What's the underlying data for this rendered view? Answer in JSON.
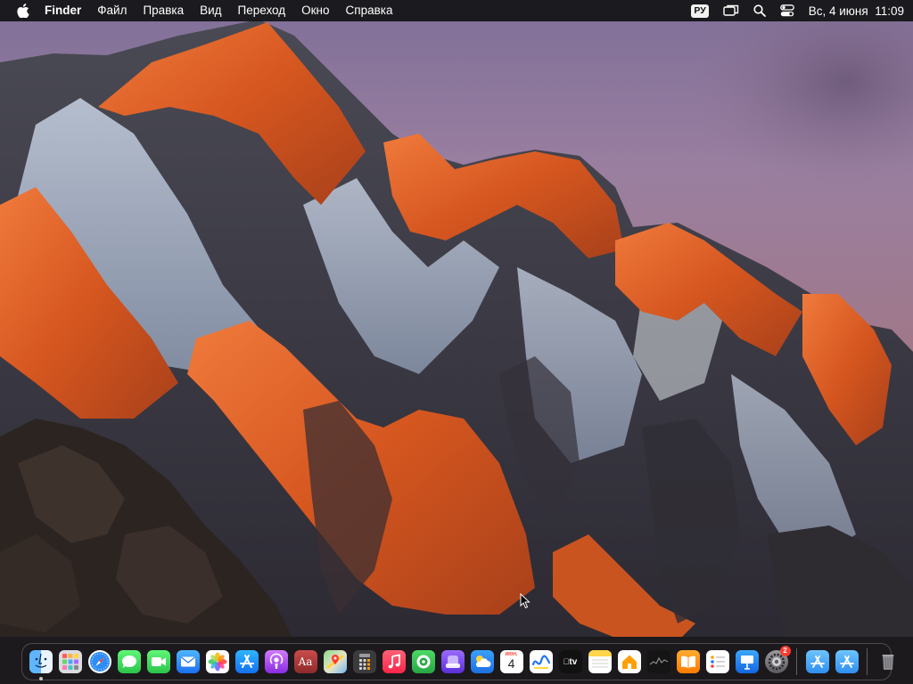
{
  "menubar": {
    "app_name": "Finder",
    "menus": [
      "Файл",
      "Правка",
      "Вид",
      "Переход",
      "Окно",
      "Справка"
    ],
    "input_source": "РУ",
    "date": "Вс, 4 июня",
    "time": "11:09"
  },
  "dock": {
    "apps": [
      {
        "name": "Finder",
        "icon": "finder-icon",
        "running": true
      },
      {
        "name": "Launchpad",
        "icon": "launchpad-icon"
      },
      {
        "name": "Safari",
        "icon": "safari-icon"
      },
      {
        "name": "Messages",
        "icon": "messages-icon"
      },
      {
        "name": "FaceTime",
        "icon": "facetime-icon"
      },
      {
        "name": "Mail",
        "icon": "mail-icon"
      },
      {
        "name": "Photos",
        "icon": "photos-icon"
      },
      {
        "name": "App Store",
        "icon": "app-store-icon"
      },
      {
        "name": "Podcasts",
        "icon": "podcasts-icon"
      },
      {
        "name": "Dictionary",
        "icon": "dictionary-icon",
        "label": "Aa"
      },
      {
        "name": "Maps",
        "icon": "maps-icon"
      },
      {
        "name": "Calculator",
        "icon": "calculator-icon"
      },
      {
        "name": "Music",
        "icon": "music-icon"
      },
      {
        "name": "Find My",
        "icon": "find-my-icon"
      },
      {
        "name": "Podcasts Alt",
        "icon": "purple-app-icon"
      },
      {
        "name": "Weather",
        "icon": "weather-icon"
      },
      {
        "name": "Calendar",
        "icon": "calendar-icon",
        "month": "ИЮН.",
        "day": "4"
      },
      {
        "name": "Freeform",
        "icon": "freeform-icon"
      },
      {
        "name": "TV",
        "icon": "tv-icon",
        "label": "tv"
      },
      {
        "name": "Notes",
        "icon": "notes-icon"
      },
      {
        "name": "Home",
        "icon": "home-icon"
      },
      {
        "name": "Stocks",
        "icon": "stocks-icon"
      },
      {
        "name": "Books",
        "icon": "books-icon"
      },
      {
        "name": "Reminders",
        "icon": "reminders-icon"
      },
      {
        "name": "Keynote",
        "icon": "keynote-icon"
      },
      {
        "name": "System Settings",
        "icon": "settings-icon",
        "badge": "2"
      }
    ],
    "folders": [
      {
        "name": "Applications",
        "icon": "applications-folder-icon"
      },
      {
        "name": "Downloads",
        "icon": "downloads-folder-icon"
      }
    ],
    "trash": {
      "name": "Trash",
      "icon": "trash-icon"
    }
  },
  "colors": {
    "menubar_bg": "#121214",
    "sunlit_rock": "#d65a24",
    "sky": "#8b7290"
  }
}
